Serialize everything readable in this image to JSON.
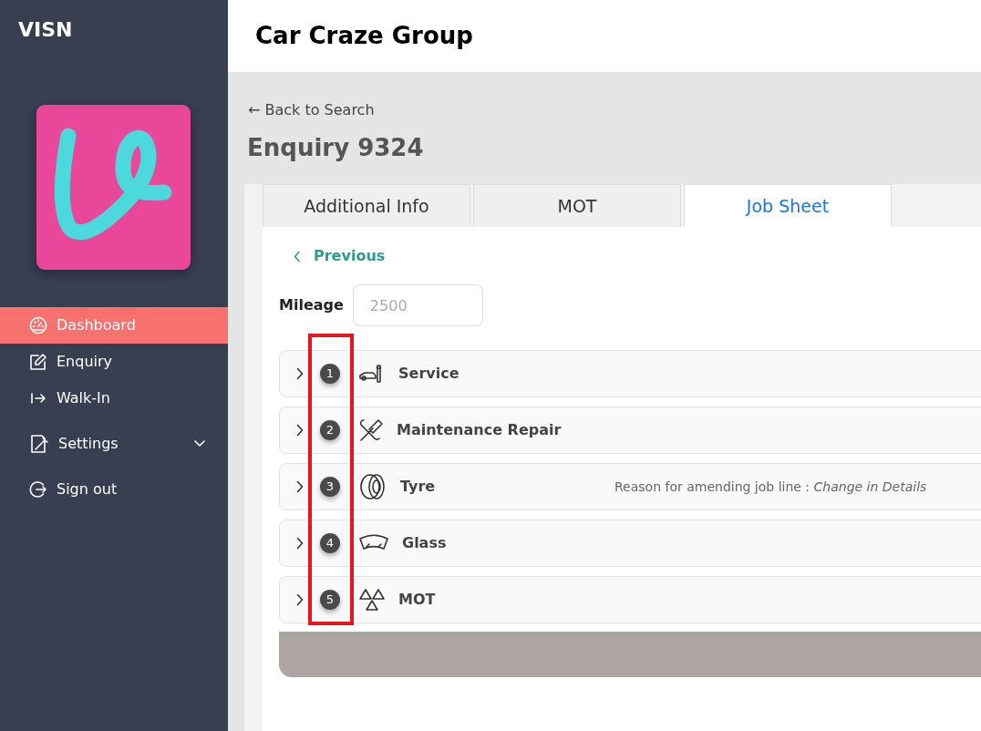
{
  "sidebar": {
    "brand": "VISN",
    "items": [
      {
        "label": "Dashboard",
        "kind": "gauge",
        "selected": true,
        "has_submenu": false
      },
      {
        "label": "Enquiry",
        "kind": "edit",
        "selected": false,
        "has_submenu": false
      },
      {
        "label": "Walk-In",
        "kind": "enter",
        "selected": false,
        "has_submenu": false
      },
      {
        "label": "Settings",
        "kind": "settings",
        "selected": false,
        "has_submenu": true
      },
      {
        "label": "Sign out",
        "kind": "signout",
        "selected": false,
        "has_submenu": false
      }
    ]
  },
  "header": {
    "title": "Car Craze Group"
  },
  "back_link": "← Back to Search",
  "page_title": "Enquiry 9324",
  "tabs": [
    {
      "label": "Additional Info",
      "selected": false
    },
    {
      "label": "MOT",
      "selected": false
    },
    {
      "label": "Job Sheet",
      "selected": true
    }
  ],
  "previous_link": "Previous",
  "mileage": {
    "label": "Mileage",
    "placeholder": "2500"
  },
  "job_lines": [
    {
      "number": "1",
      "kind": "service",
      "title": "Service",
      "expanded": false
    },
    {
      "number": "2",
      "kind": "repair",
      "title": "Maintenance Repair",
      "expanded": false
    },
    {
      "number": "3",
      "kind": "tyre",
      "title": "Tyre",
      "expanded": false,
      "note": "Reason for amending job line : *Change in Details*"
    },
    {
      "number": "4",
      "kind": "glass",
      "title": "Glass",
      "expanded": false
    },
    {
      "number": "5",
      "kind": "mot",
      "title": "MOT",
      "expanded": false
    }
  ],
  "highlight": {
    "kind": "frame"
  }
}
